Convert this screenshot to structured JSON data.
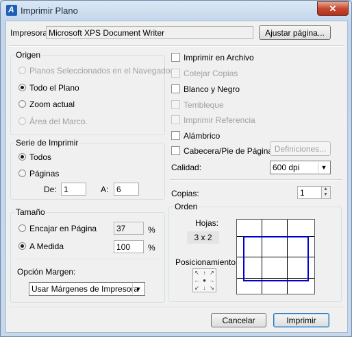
{
  "window": {
    "title": "Imprimir Plano",
    "close_glyph": "✕"
  },
  "printer": {
    "label": "Impresora:",
    "name": "Microsoft XPS Document Writer",
    "setup_button": "Ajustar página..."
  },
  "origin": {
    "title": "Origen",
    "options": [
      {
        "label": "Planos Seleccionados en el Navegador",
        "enabled": false,
        "selected": false
      },
      {
        "label": "Todo el Plano",
        "enabled": true,
        "selected": true
      },
      {
        "label": "Zoom actual",
        "enabled": true,
        "selected": false
      },
      {
        "label": "Área del Marco.",
        "enabled": false,
        "selected": false
      }
    ]
  },
  "series": {
    "title": "Serie de Imprimir",
    "all_label": "Todos",
    "pages_label": "Páginas",
    "from_label": "De:",
    "from_value": "1",
    "to_label": "A:",
    "to_value": "6"
  },
  "size": {
    "title": "Tamaño",
    "fit_label": "Encajar en Página",
    "fit_value": "37",
    "custom_label": "A Medida",
    "custom_value": "100",
    "percent": "%"
  },
  "margin": {
    "label": "Opción Margen:",
    "value": "Usar Márgenes de Impresora"
  },
  "options": [
    {
      "label": "Imprimir en Archivo",
      "enabled": true,
      "checked": false
    },
    {
      "label": "Cotejar Copias",
      "enabled": false,
      "checked": false
    },
    {
      "label": "Blanco y Negro",
      "enabled": true,
      "checked": false
    },
    {
      "label": "Tembleque",
      "enabled": false,
      "checked": false
    },
    {
      "label": "Imprimir Referencia",
      "enabled": false,
      "checked": false
    },
    {
      "label": "Alámbrico",
      "enabled": true,
      "checked": false
    },
    {
      "label": "Cabecera/Pie de Página",
      "enabled": true,
      "checked": false
    }
  ],
  "definitions_button": "Definiciones...",
  "quality": {
    "label": "Calidad:",
    "value": "600 dpi"
  },
  "copies": {
    "label": "Copias:",
    "value": "1"
  },
  "order": {
    "title": "Orden",
    "sheets_label": "Hojas:",
    "sheets_value": "3 x 2",
    "positioning_label": "Posicionamiento:",
    "arrows": [
      "↖",
      "↑",
      "↗",
      "←",
      "●",
      "→",
      "↙",
      "↓",
      "↘"
    ]
  },
  "buttons": {
    "cancel": "Cancelar",
    "print": "Imprimir"
  },
  "colors": {
    "selection_frame": "#0000cc",
    "accent": "#2b6fb6"
  }
}
